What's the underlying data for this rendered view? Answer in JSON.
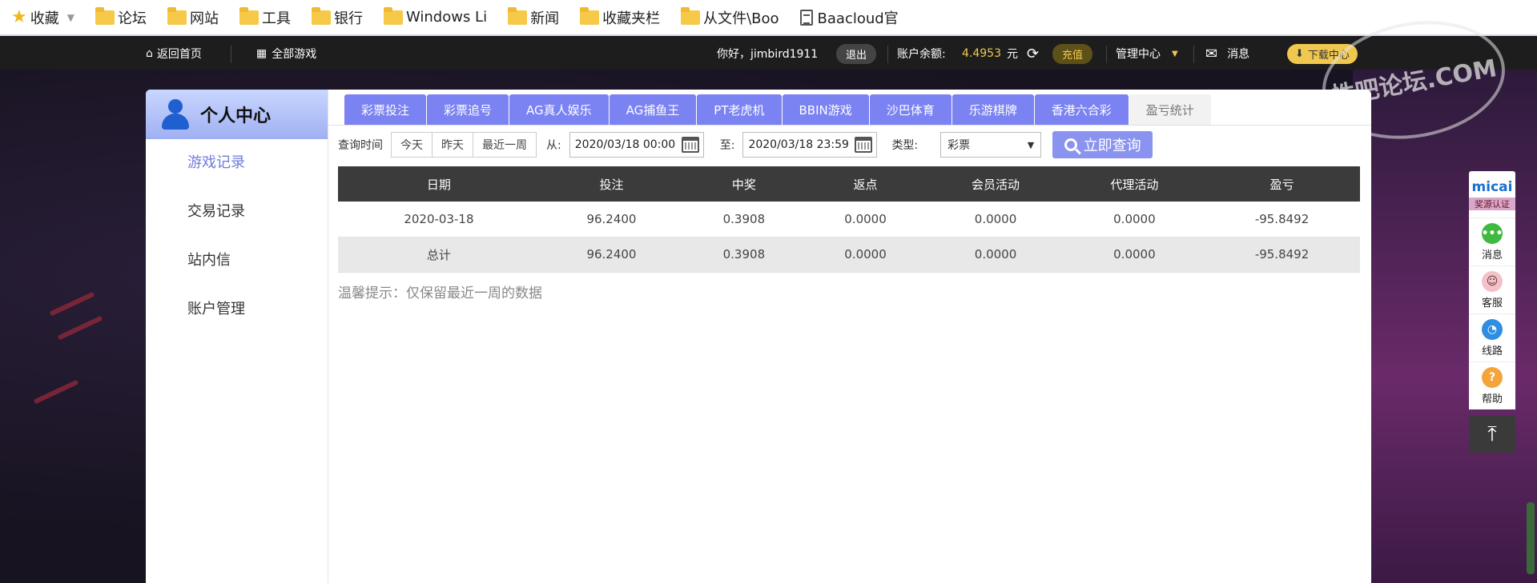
{
  "bookmarks": {
    "items": [
      "收藏",
      "论坛",
      "网站",
      "工具",
      "银行",
      "Windows Li",
      "新闻",
      "收藏夹栏",
      "从文件\\Boo",
      "Baacloud官"
    ]
  },
  "nav": {
    "home": "返回首页",
    "all_games": "全部游戏",
    "greeting": "你好，jimbird1911",
    "logout": "退出",
    "balance_label": "账户余额:",
    "balance_value": "4.4953",
    "balance_unit": "元",
    "recharge": "充值",
    "admin": "管理中心",
    "messages": "消息",
    "download": "下载中心"
  },
  "sidebar": {
    "title": "个人中心",
    "items": [
      "游戏记录",
      "交易记录",
      "站内信",
      "账户管理"
    ]
  },
  "tabs": [
    "彩票投注",
    "彩票追号",
    "AG真人娱乐",
    "AG捕鱼王",
    "PT老虎机",
    "BBIN游戏",
    "沙巴体育",
    "乐游棋牌",
    "香港六合彩",
    "盈亏统计"
  ],
  "filter": {
    "label": "查询时间",
    "quick": [
      "今天",
      "昨天",
      "最近一周"
    ],
    "from_label": "从:",
    "from_value": "2020/03/18 00:00",
    "to_label": "至:",
    "to_value": "2020/03/18 23:59",
    "type_label": "类型:",
    "type_value": "彩票",
    "query_button": "立即查询"
  },
  "table": {
    "headers": [
      "日期",
      "投注",
      "中奖",
      "返点",
      "会员活动",
      "代理活动",
      "盈亏"
    ],
    "rows": [
      [
        "2020-03-18",
        "96.2400",
        "0.3908",
        "0.0000",
        "0.0000",
        "0.0000",
        "-95.8492"
      ],
      [
        "总计",
        "96.2400",
        "0.3908",
        "0.0000",
        "0.0000",
        "0.0000",
        "-95.8492"
      ]
    ]
  },
  "hint": "温馨提示：仅保留最近一周的数据",
  "floatbar": {
    "logo": "micai",
    "cert": "奖源认证",
    "items": [
      "消息",
      "客服",
      "线路",
      "帮助"
    ],
    "up": "⤒"
  },
  "watermark": "性吧论坛.COM",
  "colors": {
    "accent": "#7b82f2",
    "gold": "#f0c850",
    "header_dark": "#3b3b3b"
  },
  "icons": [
    "star-icon",
    "folder-icon",
    "document-icon",
    "home-icon",
    "grid-icon",
    "refresh-icon",
    "mail-icon",
    "download-icon",
    "calendar-icon",
    "search-icon",
    "user-icon",
    "chat-icon",
    "support-icon",
    "route-icon",
    "help-icon",
    "back-to-top-icon"
  ]
}
